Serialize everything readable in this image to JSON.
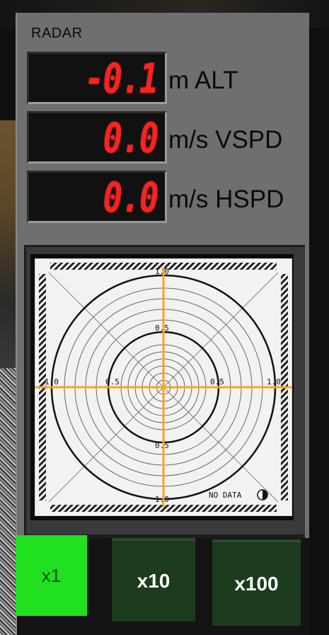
{
  "panel": {
    "title": "RADAR"
  },
  "readouts": [
    {
      "value": "-0.1",
      "unit": "m ALT"
    },
    {
      "value": "0.0",
      "unit": "m/s VSPD"
    },
    {
      "value": "0.0",
      "unit": "m/s HSPD"
    }
  ],
  "scope": {
    "status": "NO DATA",
    "tick_labels": {
      "top": "1.0",
      "upper_mid": "0.5",
      "lower_mid": "0.5",
      "bottom": "1.0",
      "left": "1.0",
      "left_mid": "0.5",
      "right_mid": "0.5",
      "right": "1.0"
    },
    "crosshair_color": "#f5a623",
    "face_color": "#f2f2f2"
  },
  "zoom_buttons": [
    {
      "label": "x1",
      "active": true
    },
    {
      "label": "x10",
      "active": false
    },
    {
      "label": "x100",
      "active": false
    }
  ],
  "colors": {
    "readout_digits": "#ff2020",
    "active_button": "#20e020",
    "inactive_button": "#1d3b1d"
  }
}
